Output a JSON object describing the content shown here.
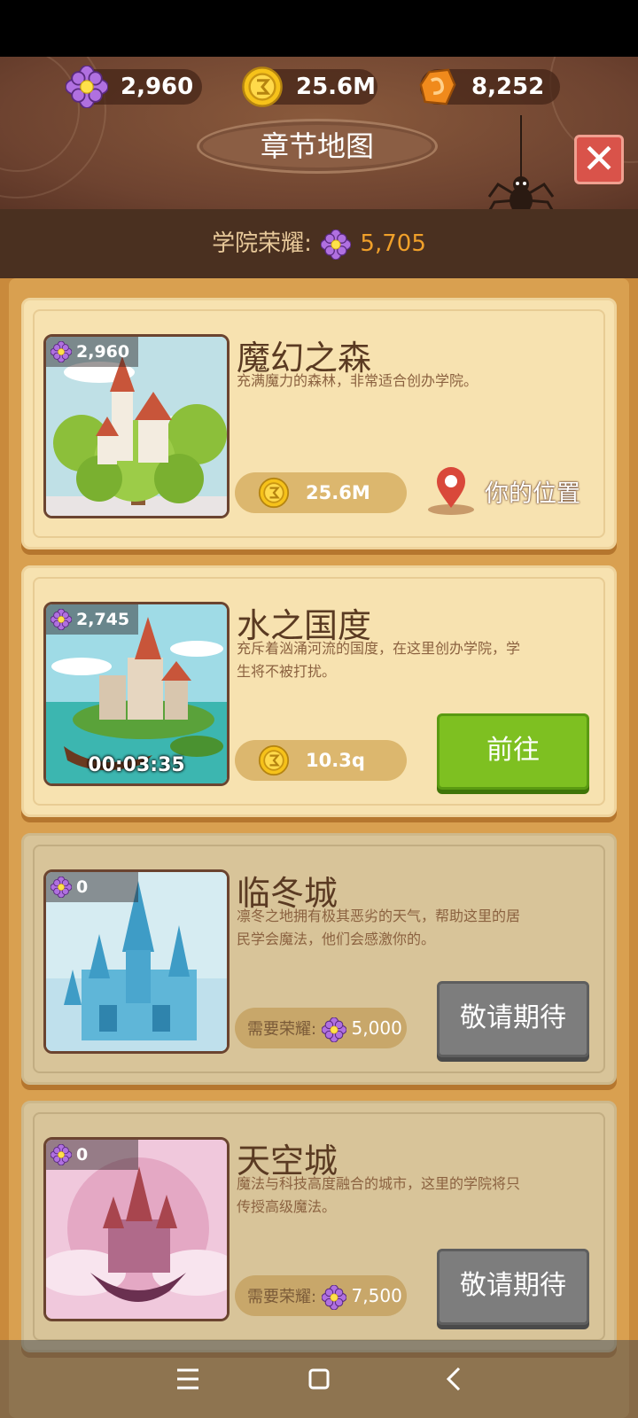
{
  "resources": [
    {
      "name": "flower-gem",
      "value": "2,960",
      "color": "#a060d0"
    },
    {
      "name": "gold-coin",
      "value": "25.6M",
      "color": "#f2c11c"
    },
    {
      "name": "amber-crystal",
      "value": "8,252",
      "color": "#f08a1c"
    }
  ],
  "header": {
    "title": "章节地图"
  },
  "academy_honor": {
    "label": "学院荣耀:",
    "value": "5,705"
  },
  "chapters": [
    {
      "name": "魔幻之森",
      "description": "充满魔力的森林，非常适合创办学院。",
      "honor": "2,960",
      "cost": "25.6M",
      "status": "你的位置",
      "locked": false
    },
    {
      "name": "水之国度",
      "description": "充斥着汹涌河流的国度，在这里创办学院，学生将不被打扰。",
      "honor": "2,745",
      "timer": "00:03:35",
      "cost": "10.3q",
      "action": "前往",
      "locked": false
    },
    {
      "name": "临冬城",
      "description": "凛冬之地拥有极其恶劣的天气，帮助这里的居民学会魔法，他们会感激你的。",
      "honor": "0",
      "requirement_label": "需要荣耀:",
      "requirement": "5,000",
      "action": "敬请期待",
      "locked": true
    },
    {
      "name": "天空城",
      "description": "魔法与科技高度融合的城市，这里的学院将只传授高级魔法。",
      "honor": "0",
      "requirement_label": "需要荣耀:",
      "requirement": "7,500",
      "action": "敬请期待",
      "locked": true
    }
  ],
  "navbar": {
    "icons": [
      "menu-icon",
      "home-icon",
      "back-icon"
    ]
  }
}
